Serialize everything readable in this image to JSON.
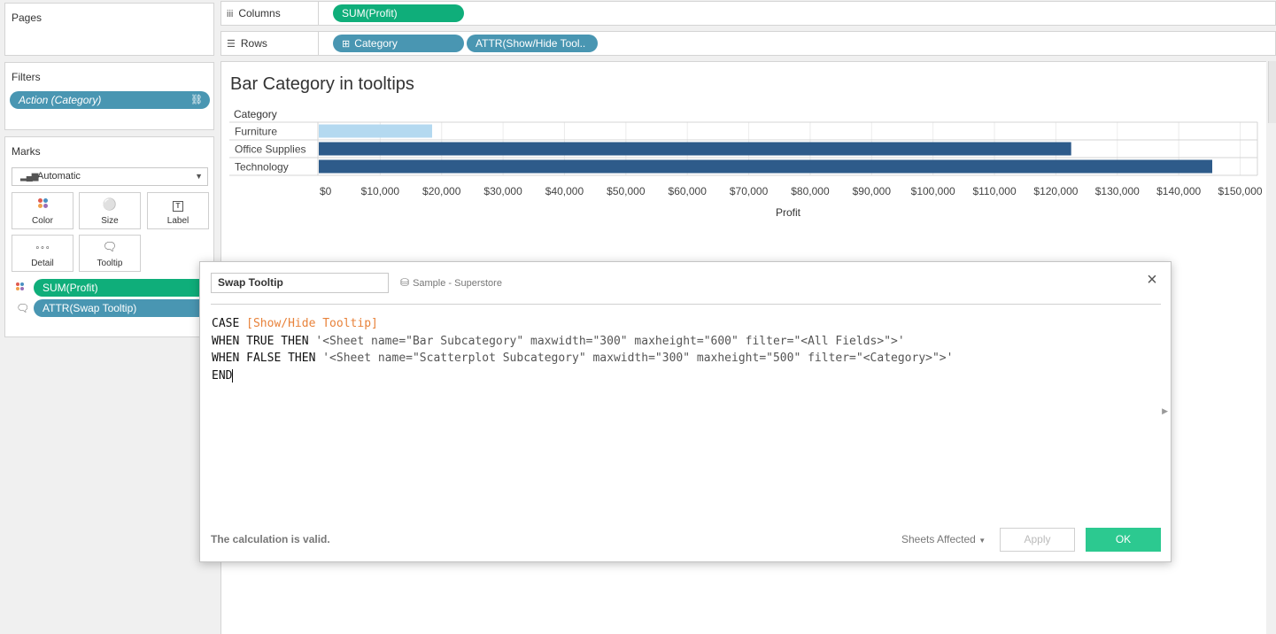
{
  "panes": {
    "pages_title": "Pages",
    "filters_title": "Filters",
    "marks_title": "Marks"
  },
  "filters": {
    "items": [
      {
        "label": "Action (Category)"
      }
    ]
  },
  "marks": {
    "type": "Automatic",
    "buttons": {
      "color": "Color",
      "size": "Size",
      "label": "Label",
      "detail": "Detail",
      "tooltip": "Tooltip"
    },
    "fields": [
      {
        "label": "SUM(Profit)",
        "icon": "color-dots-icon"
      },
      {
        "label": "ATTR(Swap Tooltip)",
        "icon": "tooltip-bubble-icon"
      }
    ]
  },
  "shelves": {
    "columns_label": "Columns",
    "rows_label": "Rows",
    "columns_pills": [
      "SUM(Profit)"
    ],
    "rows_pills": [
      "Category",
      "ATTR(Show/Hide Tool.."
    ]
  },
  "sheet": {
    "title": "Bar Category in tooltips"
  },
  "chart_data": {
    "type": "bar",
    "orientation": "horizontal",
    "row_header": "Category",
    "categories": [
      "Furniture",
      "Office Supplies",
      "Technology"
    ],
    "values": [
      18451,
      122491,
      145455
    ],
    "bar_colors": [
      "#b4d9f0",
      "#2e5b8a",
      "#2e5b8a"
    ],
    "xlabel": "Profit",
    "xlim": [
      0,
      152000
    ],
    "ticks": [
      0,
      10000,
      20000,
      30000,
      40000,
      50000,
      60000,
      70000,
      80000,
      90000,
      100000,
      110000,
      120000,
      130000,
      140000,
      150000
    ],
    "tick_labels": [
      "$0",
      "$10,000",
      "$20,000",
      "$30,000",
      "$40,000",
      "$50,000",
      "$60,000",
      "$70,000",
      "$80,000",
      "$90,000",
      "$100,000",
      "$110,000",
      "$120,000",
      "$130,000",
      "$140,000",
      "$150,000"
    ],
    "grid": true
  },
  "dialog": {
    "calc_name": "Swap Tooltip",
    "datasource": "Sample - Superstore",
    "code": {
      "line1_kw": "CASE ",
      "line1_field": "[Show/Hide Tooltip]",
      "line2_kw": "WHEN TRUE THEN ",
      "line2_str": "'<Sheet name=\"Bar Subcategory\" maxwidth=\"300\" maxheight=\"600\" filter=\"<All Fields>\">'",
      "line3_kw": "WHEN FALSE THEN ",
      "line3_str": "'<Sheet name=\"Scatterplot Subcategory\" maxwidth=\"300\" maxheight=\"500\" filter=\"<Category>\">'",
      "line4_kw": "END"
    },
    "status": "The calculation is valid.",
    "sheets_affected": "Sheets Affected",
    "apply": "Apply",
    "ok": "OK"
  },
  "colors": {
    "pill_blue": "#4996b2",
    "pill_green": "#0fae7a",
    "bar_dark": "#2e5b8a",
    "bar_light": "#b4d9f0",
    "ok_green": "#2cc990",
    "field_orange": "#e8823a"
  }
}
